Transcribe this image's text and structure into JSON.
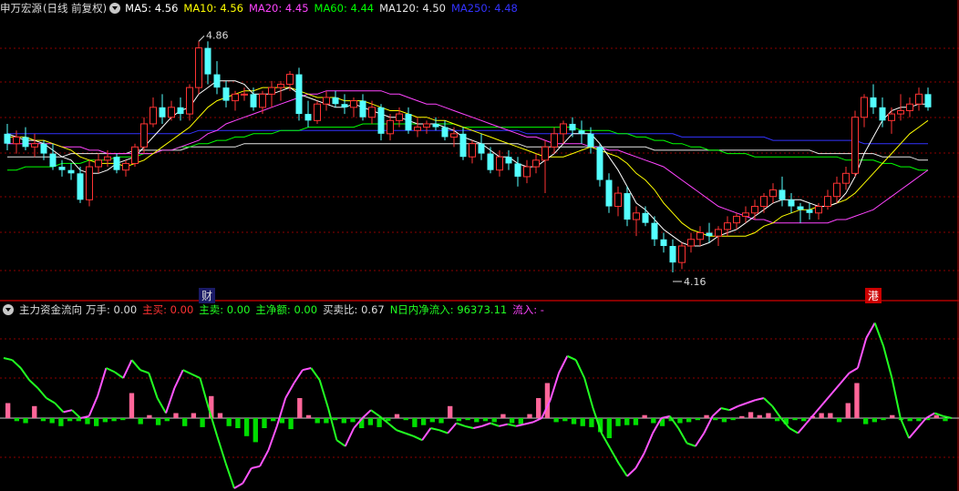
{
  "colors": {
    "ma5": "#ffffff",
    "ma10": "#ffff00",
    "ma20": "#ff44ff",
    "ma60": "#00ff00",
    "ma120": "#e6e6e6",
    "ma250": "#3333ff",
    "up": "#ff3333",
    "down": "#54ffff",
    "grid": "#8b0000",
    "flow_up": "#ff55ff",
    "flow_dn": "#22ff22",
    "bar_pos": "#ff6699",
    "bar_neg": "#00dd00"
  },
  "price_panel": {
    "stock_name": "申万宏源",
    "mode": "(日线 前复权)",
    "ma_items": [
      {
        "label": "MA5: 4.56",
        "key": "ma5"
      },
      {
        "label": "MA10: 4.56",
        "key": "ma10"
      },
      {
        "label": "MA20: 4.45",
        "key": "ma20"
      },
      {
        "label": "MA60: 4.44",
        "key": "ma60"
      },
      {
        "label": "MA120: 4.50",
        "key": "ma120"
      },
      {
        "label": "MA250: 4.48",
        "key": "ma250"
      }
    ],
    "high_label": "4.86",
    "low_label": "4.16",
    "marker_cai": "财",
    "marker_gang": "港"
  },
  "flow_panel": {
    "title": "主力资金流向",
    "items": [
      {
        "label": "万手: 0.00",
        "color": "#dddddd"
      },
      {
        "label": "主买: 0.00",
        "color": "#ff3333"
      },
      {
        "label": "主卖: 0.00",
        "color": "#22ff22"
      },
      {
        "label": "主净额: 0.00",
        "color": "#22ff22"
      },
      {
        "label": "买卖比: 0.67",
        "color": "#dddddd"
      },
      {
        "label": "N日内净流入: 96373.11",
        "color": "#22ff22"
      },
      {
        "label": "流入: -",
        "color": "#ff44ff"
      }
    ]
  },
  "chart_data": {
    "type": "candlestick",
    "price_range": [
      4.08,
      4.93
    ],
    "candles": [
      [
        4.58,
        4.61,
        4.53,
        4.55
      ],
      [
        4.55,
        4.59,
        4.52,
        4.57
      ],
      [
        4.57,
        4.6,
        4.53,
        4.54
      ],
      [
        4.54,
        4.58,
        4.51,
        4.55
      ],
      [
        4.55,
        4.56,
        4.5,
        4.52
      ],
      [
        4.52,
        4.55,
        4.47,
        4.48
      ],
      [
        4.48,
        4.5,
        4.45,
        4.47
      ],
      [
        4.47,
        4.49,
        4.44,
        4.46
      ],
      [
        4.46,
        4.48,
        4.37,
        4.38
      ],
      [
        4.38,
        4.5,
        4.36,
        4.48
      ],
      [
        4.48,
        4.52,
        4.46,
        4.5
      ],
      [
        4.5,
        4.53,
        4.48,
        4.51
      ],
      [
        4.51,
        4.52,
        4.46,
        4.47
      ],
      [
        4.47,
        4.5,
        4.45,
        4.49
      ],
      [
        4.49,
        4.55,
        4.48,
        4.54
      ],
      [
        4.54,
        4.63,
        4.52,
        4.61
      ],
      [
        4.61,
        4.69,
        4.6,
        4.66
      ],
      [
        4.66,
        4.7,
        4.61,
        4.63
      ],
      [
        4.63,
        4.68,
        4.62,
        4.66
      ],
      [
        4.66,
        4.69,
        4.62,
        4.64
      ],
      [
        4.64,
        4.73,
        4.62,
        4.72
      ],
      [
        4.72,
        4.86,
        4.7,
        4.84
      ],
      [
        4.84,
        4.86,
        4.73,
        4.76
      ],
      [
        4.76,
        4.8,
        4.7,
        4.72
      ],
      [
        4.72,
        4.74,
        4.66,
        4.68
      ],
      [
        4.68,
        4.71,
        4.65,
        4.7
      ],
      [
        4.7,
        4.72,
        4.68,
        4.7
      ],
      [
        4.7,
        4.72,
        4.65,
        4.66
      ],
      [
        4.66,
        4.71,
        4.64,
        4.7
      ],
      [
        4.7,
        4.74,
        4.66,
        4.72
      ],
      [
        4.72,
        4.74,
        4.68,
        4.73
      ],
      [
        4.73,
        4.77,
        4.71,
        4.76
      ],
      [
        4.76,
        4.78,
        4.62,
        4.64
      ],
      [
        4.64,
        4.68,
        4.6,
        4.62
      ],
      [
        4.62,
        4.68,
        4.61,
        4.67
      ],
      [
        4.67,
        4.71,
        4.65,
        4.69
      ],
      [
        4.69,
        4.71,
        4.66,
        4.67
      ],
      [
        4.67,
        4.7,
        4.64,
        4.66
      ],
      [
        4.66,
        4.69,
        4.63,
        4.68
      ],
      [
        4.68,
        4.7,
        4.62,
        4.63
      ],
      [
        4.63,
        4.68,
        4.61,
        4.66
      ],
      [
        4.66,
        4.67,
        4.56,
        4.58
      ],
      [
        4.58,
        4.64,
        4.56,
        4.62
      ],
      [
        4.62,
        4.66,
        4.6,
        4.64
      ],
      [
        4.64,
        4.66,
        4.58,
        4.59
      ],
      [
        4.59,
        4.63,
        4.57,
        4.6
      ],
      [
        4.6,
        4.62,
        4.58,
        4.61
      ],
      [
        4.61,
        4.63,
        4.59,
        4.6
      ],
      [
        4.6,
        4.62,
        4.56,
        4.57
      ],
      [
        4.57,
        4.6,
        4.54,
        4.58
      ],
      [
        4.58,
        4.6,
        4.5,
        4.51
      ],
      [
        4.51,
        4.56,
        4.49,
        4.55
      ],
      [
        4.55,
        4.58,
        4.5,
        4.52
      ],
      [
        4.52,
        4.54,
        4.46,
        4.47
      ],
      [
        4.47,
        4.53,
        4.45,
        4.51
      ],
      [
        4.51,
        4.53,
        4.47,
        4.49
      ],
      [
        4.49,
        4.51,
        4.42,
        4.45
      ],
      [
        4.45,
        4.5,
        4.43,
        4.48
      ],
      [
        4.48,
        4.52,
        4.46,
        4.5
      ],
      [
        4.5,
        4.56,
        4.4,
        4.54
      ],
      [
        4.54,
        4.6,
        4.52,
        4.58
      ],
      [
        4.58,
        4.62,
        4.55,
        4.61
      ],
      [
        4.61,
        4.63,
        4.57,
        4.59
      ],
      [
        4.59,
        4.62,
        4.55,
        4.58
      ],
      [
        4.58,
        4.6,
        4.52,
        4.54
      ],
      [
        4.54,
        4.55,
        4.42,
        4.44
      ],
      [
        4.44,
        4.46,
        4.34,
        4.36
      ],
      [
        4.36,
        4.42,
        4.33,
        4.4
      ],
      [
        4.4,
        4.42,
        4.3,
        4.32
      ],
      [
        4.32,
        4.36,
        4.27,
        4.34
      ],
      [
        4.34,
        4.36,
        4.3,
        4.31
      ],
      [
        4.31,
        4.33,
        4.24,
        4.26
      ],
      [
        4.26,
        4.28,
        4.22,
        4.24
      ],
      [
        4.24,
        4.26,
        4.16,
        4.19
      ],
      [
        4.19,
        4.25,
        4.17,
        4.24
      ],
      [
        4.24,
        4.28,
        4.22,
        4.26
      ],
      [
        4.26,
        4.3,
        4.24,
        4.28
      ],
      [
        4.28,
        4.31,
        4.25,
        4.27
      ],
      [
        4.27,
        4.3,
        4.24,
        4.29
      ],
      [
        4.29,
        4.33,
        4.27,
        4.31
      ],
      [
        4.31,
        4.34,
        4.29,
        4.33
      ],
      [
        4.33,
        4.36,
        4.31,
        4.34
      ],
      [
        4.34,
        4.38,
        4.32,
        4.36
      ],
      [
        4.36,
        4.4,
        4.34,
        4.39
      ],
      [
        4.39,
        4.43,
        4.37,
        4.41
      ],
      [
        4.41,
        4.45,
        4.36,
        4.38
      ],
      [
        4.38,
        4.4,
        4.34,
        4.36
      ],
      [
        4.36,
        4.37,
        4.31,
        4.35
      ],
      [
        4.35,
        4.37,
        4.32,
        4.34
      ],
      [
        4.34,
        4.37,
        4.32,
        4.36
      ],
      [
        4.36,
        4.41,
        4.35,
        4.39
      ],
      [
        4.39,
        4.45,
        4.37,
        4.43
      ],
      [
        4.43,
        4.48,
        4.41,
        4.46
      ],
      [
        4.46,
        4.65,
        4.45,
        4.63
      ],
      [
        4.63,
        4.7,
        4.6,
        4.69
      ],
      [
        4.69,
        4.73,
        4.64,
        4.66
      ],
      [
        4.66,
        4.69,
        4.6,
        4.62
      ],
      [
        4.62,
        4.66,
        4.58,
        4.64
      ],
      [
        4.64,
        4.7,
        4.62,
        4.65
      ],
      [
        4.65,
        4.69,
        4.63,
        4.67
      ],
      [
        4.67,
        4.72,
        4.65,
        4.7
      ],
      [
        4.7,
        4.72,
        4.65,
        4.66
      ]
    ],
    "ma5": [
      4.58,
      4.57,
      4.56,
      4.56,
      4.55,
      4.53,
      4.51,
      4.5,
      4.47,
      4.46,
      4.46,
      4.47,
      4.49,
      4.5,
      4.51,
      4.54,
      4.57,
      4.6,
      4.63,
      4.65,
      4.66,
      4.7,
      4.72,
      4.74,
      4.74,
      4.74,
      4.73,
      4.7,
      4.7,
      4.7,
      4.71,
      4.72,
      4.7,
      4.69,
      4.68,
      4.67,
      4.66,
      4.66,
      4.67,
      4.66,
      4.65,
      4.64,
      4.63,
      4.63,
      4.62,
      4.61,
      4.61,
      4.61,
      4.6,
      4.59,
      4.57,
      4.56,
      4.55,
      4.53,
      4.51,
      4.51,
      4.49,
      4.48,
      4.48,
      4.5,
      4.52,
      4.55,
      4.58,
      4.58,
      4.58,
      4.55,
      4.51,
      4.47,
      4.42,
      4.37,
      4.35,
      4.32,
      4.29,
      4.27,
      4.25,
      4.24,
      4.24,
      4.25,
      4.27,
      4.28,
      4.29,
      4.31,
      4.33,
      4.35,
      4.37,
      4.38,
      4.38,
      4.38,
      4.37,
      4.36,
      4.36,
      4.37,
      4.4,
      4.45,
      4.52,
      4.57,
      4.62,
      4.65,
      4.66,
      4.66,
      4.67,
      4.67
    ],
    "ma10": [
      4.57,
      4.57,
      4.57,
      4.56,
      4.56,
      4.55,
      4.54,
      4.53,
      4.51,
      4.5,
      4.49,
      4.49,
      4.49,
      4.48,
      4.49,
      4.5,
      4.52,
      4.54,
      4.56,
      4.58,
      4.6,
      4.63,
      4.66,
      4.68,
      4.69,
      4.7,
      4.71,
      4.71,
      4.72,
      4.72,
      4.72,
      4.72,
      4.71,
      4.7,
      4.69,
      4.69,
      4.69,
      4.68,
      4.68,
      4.68,
      4.67,
      4.66,
      4.65,
      4.65,
      4.64,
      4.63,
      4.63,
      4.62,
      4.62,
      4.61,
      4.6,
      4.59,
      4.58,
      4.57,
      4.56,
      4.55,
      4.54,
      4.53,
      4.52,
      4.51,
      4.51,
      4.51,
      4.52,
      4.53,
      4.54,
      4.53,
      4.52,
      4.51,
      4.49,
      4.46,
      4.44,
      4.41,
      4.37,
      4.34,
      4.31,
      4.29,
      4.28,
      4.27,
      4.27,
      4.27,
      4.27,
      4.27,
      4.28,
      4.3,
      4.31,
      4.33,
      4.34,
      4.35,
      4.35,
      4.36,
      4.36,
      4.37,
      4.38,
      4.4,
      4.43,
      4.46,
      4.49,
      4.52,
      4.55,
      4.58,
      4.6,
      4.62
    ],
    "ma20": [
      4.55,
      4.55,
      4.55,
      4.55,
      4.55,
      4.55,
      4.54,
      4.54,
      4.54,
      4.53,
      4.53,
      4.52,
      4.52,
      4.52,
      4.52,
      4.52,
      4.52,
      4.53,
      4.53,
      4.54,
      4.55,
      4.56,
      4.58,
      4.59,
      4.61,
      4.62,
      4.63,
      4.64,
      4.65,
      4.66,
      4.67,
      4.68,
      4.69,
      4.7,
      4.7,
      4.71,
      4.71,
      4.71,
      4.71,
      4.71,
      4.71,
      4.71,
      4.7,
      4.7,
      4.69,
      4.68,
      4.67,
      4.67,
      4.66,
      4.65,
      4.64,
      4.63,
      4.62,
      4.61,
      4.6,
      4.59,
      4.58,
      4.57,
      4.57,
      4.56,
      4.55,
      4.55,
      4.55,
      4.55,
      4.54,
      4.54,
      4.53,
      4.53,
      4.52,
      4.51,
      4.5,
      4.49,
      4.48,
      4.46,
      4.44,
      4.42,
      4.4,
      4.38,
      4.36,
      4.35,
      4.34,
      4.33,
      4.32,
      4.32,
      4.31,
      4.31,
      4.31,
      4.31,
      4.31,
      4.31,
      4.31,
      4.32,
      4.32,
      4.33,
      4.34,
      4.35,
      4.37,
      4.39,
      4.41,
      4.43,
      4.45,
      4.47
    ],
    "ma60": [
      4.47,
      4.47,
      4.48,
      4.48,
      4.48,
      4.48,
      4.49,
      4.49,
      4.49,
      4.5,
      4.5,
      4.5,
      4.51,
      4.51,
      4.51,
      4.52,
      4.52,
      4.53,
      4.53,
      4.54,
      4.54,
      4.55,
      4.55,
      4.56,
      4.56,
      4.57,
      4.57,
      4.58,
      4.58,
      4.58,
      4.59,
      4.59,
      4.59,
      4.6,
      4.6,
      4.6,
      4.6,
      4.6,
      4.6,
      4.61,
      4.61,
      4.61,
      4.61,
      4.61,
      4.61,
      4.61,
      4.61,
      4.61,
      4.61,
      4.61,
      4.6,
      4.6,
      4.6,
      4.6,
      4.6,
      4.6,
      4.6,
      4.6,
      4.6,
      4.6,
      4.6,
      4.6,
      4.6,
      4.59,
      4.59,
      4.59,
      4.59,
      4.58,
      4.58,
      4.57,
      4.57,
      4.56,
      4.56,
      4.55,
      4.55,
      4.54,
      4.54,
      4.53,
      4.53,
      4.52,
      4.52,
      4.52,
      4.51,
      4.51,
      4.51,
      4.51,
      4.51,
      4.51,
      4.51,
      4.51,
      4.51,
      4.51,
      4.5,
      4.5,
      4.5,
      4.5,
      4.49,
      4.49,
      4.48,
      4.48,
      4.47,
      4.47
    ],
    "ma120": [
      4.51,
      4.51,
      4.51,
      4.51,
      4.51,
      4.51,
      4.51,
      4.52,
      4.52,
      4.52,
      4.52,
      4.52,
      4.52,
      4.52,
      4.53,
      4.53,
      4.53,
      4.53,
      4.53,
      4.53,
      4.54,
      4.54,
      4.54,
      4.54,
      4.54,
      4.54,
      4.55,
      4.55,
      4.55,
      4.55,
      4.55,
      4.55,
      4.55,
      4.55,
      4.55,
      4.55,
      4.55,
      4.55,
      4.55,
      4.55,
      4.55,
      4.55,
      4.55,
      4.55,
      4.55,
      4.55,
      4.55,
      4.55,
      4.55,
      4.55,
      4.55,
      4.55,
      4.55,
      4.55,
      4.55,
      4.55,
      4.55,
      4.54,
      4.54,
      4.54,
      4.54,
      4.54,
      4.54,
      4.54,
      4.54,
      4.54,
      4.54,
      4.54,
      4.54,
      4.54,
      4.54,
      4.53,
      4.53,
      4.53,
      4.53,
      4.53,
      4.53,
      4.53,
      4.53,
      4.53,
      4.53,
      4.53,
      4.53,
      4.53,
      4.53,
      4.53,
      4.53,
      4.53,
      4.53,
      4.52,
      4.52,
      4.52,
      4.52,
      4.52,
      4.52,
      4.52,
      4.51,
      4.51,
      4.51,
      4.51,
      4.5,
      4.5
    ],
    "ma250": [
      4.58,
      4.58,
      4.58,
      4.58,
      4.58,
      4.58,
      4.58,
      4.58,
      4.58,
      4.58,
      4.58,
      4.58,
      4.58,
      4.58,
      4.58,
      4.58,
      4.58,
      4.58,
      4.58,
      4.58,
      4.58,
      4.59,
      4.59,
      4.59,
      4.59,
      4.59,
      4.59,
      4.59,
      4.59,
      4.59,
      4.59,
      4.59,
      4.59,
      4.59,
      4.59,
      4.59,
      4.59,
      4.59,
      4.59,
      4.59,
      4.59,
      4.59,
      4.59,
      4.59,
      4.59,
      4.59,
      4.59,
      4.59,
      4.59,
      4.59,
      4.59,
      4.59,
      4.59,
      4.59,
      4.59,
      4.59,
      4.59,
      4.58,
      4.58,
      4.58,
      4.58,
      4.58,
      4.58,
      4.58,
      4.58,
      4.58,
      4.58,
      4.58,
      4.58,
      4.58,
      4.58,
      4.58,
      4.58,
      4.58,
      4.57,
      4.57,
      4.57,
      4.57,
      4.57,
      4.57,
      4.57,
      4.57,
      4.57,
      4.57,
      4.56,
      4.56,
      4.56,
      4.56,
      4.56,
      4.56,
      4.56,
      4.56,
      4.56,
      4.56,
      4.55,
      4.55,
      4.55,
      4.55,
      4.55,
      4.55,
      4.55,
      4.55
    ],
    "flow_line": [
      60,
      58,
      50,
      38,
      30,
      20,
      15,
      6,
      8,
      0,
      2,
      22,
      50,
      46,
      40,
      58,
      48,
      45,
      20,
      5,
      30,
      48,
      44,
      40,
      10,
      -18,
      -45,
      -70,
      -65,
      -50,
      -48,
      -32,
      -8,
      20,
      35,
      48,
      50,
      38,
      10,
      -22,
      -28,
      -10,
      0,
      8,
      2,
      -5,
      -12,
      -15,
      -18,
      -22,
      -10,
      -12,
      -15,
      -5,
      -8,
      -10,
      -8,
      -5,
      -8,
      -6,
      -8,
      -6,
      -4,
      0,
      18,
      45,
      62,
      58,
      40,
      10,
      -15,
      -30,
      -45,
      -58,
      -50,
      -35,
      -15,
      0,
      2,
      -10,
      -25,
      -28,
      -15,
      2,
      10,
      8,
      12,
      15,
      18,
      20,
      12,
      0,
      -10,
      -15,
      -5,
      5,
      15,
      25,
      35,
      45,
      50,
      80,
      95,
      72,
      40,
      0,
      -20,
      -10,
      0,
      5,
      2,
      0
    ],
    "flow_bars": [
      15,
      -3,
      -5,
      12,
      -3,
      -5,
      -8,
      -3,
      -3,
      -6,
      -8,
      -4,
      -3,
      -2,
      25,
      -6,
      3,
      -7,
      -3,
      5,
      -8,
      5,
      -9,
      22,
      5,
      -8,
      -10,
      -18,
      -24,
      -10,
      -3,
      -5,
      -11,
      20,
      3,
      -5,
      -5,
      -2,
      -5,
      -4,
      -10,
      -7,
      -9,
      -3,
      4,
      -2,
      -9,
      -7,
      -4,
      -5,
      12,
      -3,
      -2,
      -4,
      -3,
      -4,
      4,
      -5,
      -6,
      4,
      20,
      35,
      -4,
      -3,
      -6,
      -8,
      -9,
      -14,
      -20,
      -8,
      -7,
      -7,
      3,
      -5,
      -8,
      -3,
      -5,
      -4,
      -2,
      3,
      -2,
      -4,
      -2,
      2,
      6,
      3,
      5,
      -3,
      -6,
      -2,
      -3,
      2,
      5,
      5,
      -4,
      15,
      35,
      -6,
      -4,
      -2,
      3,
      -2,
      -3,
      -3,
      -2,
      3,
      -3
    ]
  }
}
